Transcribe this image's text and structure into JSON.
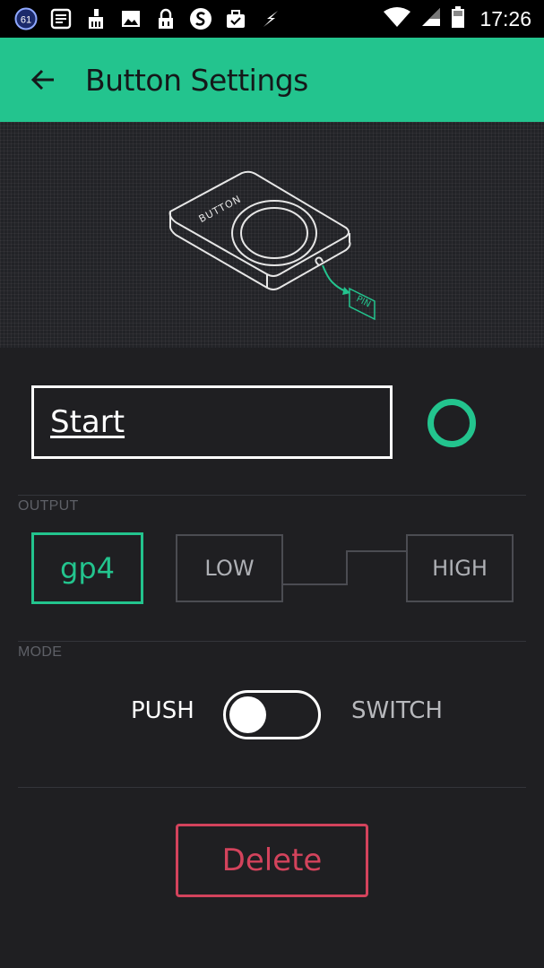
{
  "status_bar": {
    "notification_badge": "61",
    "time": "17:26",
    "icons": [
      "notification-count-icon",
      "list-icon",
      "cleaner-icon",
      "image-icon",
      "lock-icon",
      "app-s-icon",
      "briefcase-icon",
      "flash-icon",
      "wifi-icon",
      "signal-icon",
      "battery-icon"
    ]
  },
  "app_bar": {
    "back_icon": "arrow-left-icon",
    "title": "Button Settings"
  },
  "hero": {
    "device_label": "BUTTON",
    "pin_label": "PIN"
  },
  "name_field": {
    "value": "Start"
  },
  "color_picker": {
    "color": "#23c48e"
  },
  "output": {
    "label": "OUTPUT",
    "pin": "gp4",
    "low": "LOW",
    "high": "HIGH"
  },
  "mode": {
    "label": "MODE",
    "push": "PUSH",
    "switch": "SWITCH",
    "is_switch": false
  },
  "delete_button": {
    "label": "Delete"
  },
  "colors": {
    "accent": "#23c48e",
    "danger": "#d3435c",
    "background": "#1f1f22"
  }
}
